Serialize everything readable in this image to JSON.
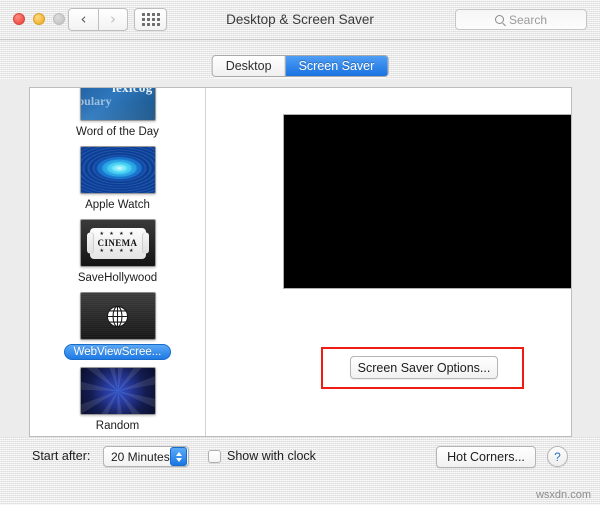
{
  "window": {
    "title": "Desktop & Screen Saver",
    "traffic_lights": [
      "close-red",
      "minimize-yellow",
      "zoom-gray-disabled"
    ],
    "toolbar": {
      "back_icon": "chevron-left-icon",
      "back_glyph": "‹",
      "forward_icon": "chevron-right-icon",
      "forward_glyph": "›",
      "show_all_icon": "grid-dots-icon"
    },
    "search": {
      "icon": "search-icon",
      "placeholder": "Search",
      "value": ""
    }
  },
  "tabs": [
    {
      "label": "Desktop",
      "selected": false
    },
    {
      "label": "Screen Saver",
      "selected": true
    }
  ],
  "sidebar": {
    "items": [
      {
        "label": "Word of the Day",
        "thumb": "word-of-the-day-thumbnail",
        "selected": false,
        "art_text_1": "lexicog",
        "art_text_2": "bulary"
      },
      {
        "label": "Apple Watch",
        "thumb": "apple-watch-thumbnail",
        "selected": false
      },
      {
        "label": "SaveHollywood",
        "thumb": "savehollywood-thumbnail",
        "selected": false,
        "ticket_text": "CINEMA",
        "ticket_stars": "★ ★ ★ ★"
      },
      {
        "label": "WebViewScree...",
        "thumb": "webviewscreensaver-thumbnail",
        "selected": true,
        "icon": "globe-icon"
      },
      {
        "label": "Random",
        "thumb": "random-thumbnail",
        "selected": false
      }
    ]
  },
  "preview": {
    "name": "screen-saver-preview",
    "background": "#000000"
  },
  "options": {
    "button_label": "Screen Saver Options...",
    "annotation_color": "#ef1c14"
  },
  "bottom": {
    "start_after_label": "Start after:",
    "start_after_value": "20 Minutes",
    "show_with_clock_label": "Show with clock",
    "show_with_clock_checked": false,
    "hot_corners_label": "Hot Corners...",
    "help_label": "?"
  },
  "watermark": "wsxdn.com",
  "colors": {
    "accent_blue": "#1f7ae4",
    "annotation_red": "#ef1c14",
    "panel_white": "#ffffff",
    "chrome_gray": "#eaeaea"
  }
}
